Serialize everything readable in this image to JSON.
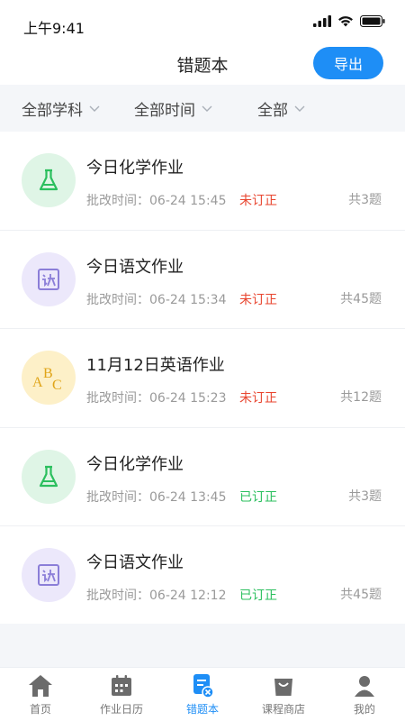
{
  "status_bar": {
    "time": "上午9:41"
  },
  "header": {
    "title": "错题本",
    "export_label": "导出"
  },
  "filters": [
    {
      "label": "全部学科"
    },
    {
      "label": "全部时间"
    },
    {
      "label": "全部"
    }
  ],
  "items": [
    {
      "title": "今日化学作业",
      "meta": "批改时间：06-24 15:45",
      "status": "未订正",
      "count": "共3题",
      "icon": "flask-icon",
      "status_color": "#e8452f"
    },
    {
      "title": "今日语文作业",
      "meta": "批改时间：06-24 15:34",
      "status": "未订正",
      "count": "共45题",
      "icon": "chinese-book-icon",
      "status_color": "#e8452f"
    },
    {
      "title": "11月12日英语作业",
      "meta": "批改时间：06-24 15:23",
      "status": "未订正",
      "count": "共12题",
      "icon": "abc-icon",
      "status_color": "#e8452f"
    },
    {
      "title": "今日化学作业",
      "meta": "批改时间：06-24 13:45",
      "status": "已订正",
      "count": "共3题",
      "icon": "flask-icon",
      "status_color": "#2bbf5e"
    },
    {
      "title": "今日语文作业",
      "meta": "批改时间：06-24 12:12",
      "status": "已订正",
      "count": "共45题",
      "icon": "chinese-book-icon",
      "status_color": "#2bbf5e"
    }
  ],
  "tabbar": [
    {
      "label": "首页",
      "icon": "home-icon"
    },
    {
      "label": "作业日历",
      "icon": "calendar-icon"
    },
    {
      "label": "错题本",
      "icon": "mistake-book-icon",
      "active": true
    },
    {
      "label": "课程商店",
      "icon": "shop-bag-icon"
    },
    {
      "label": "我的",
      "icon": "profile-icon"
    }
  ],
  "colors": {
    "accent": "#1e8ef6",
    "pending": "#e8452f",
    "done": "#2bbf5e"
  }
}
